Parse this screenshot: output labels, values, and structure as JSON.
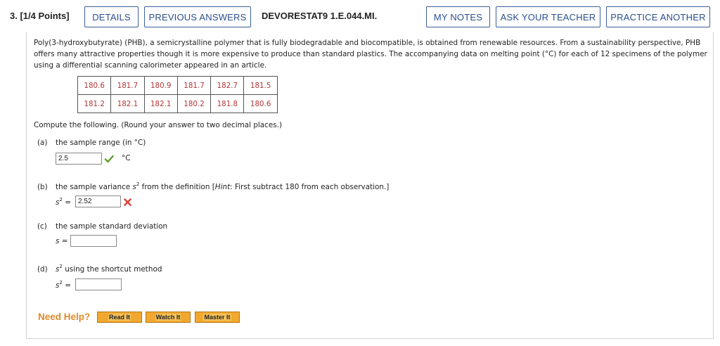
{
  "header": {
    "question_label": "3. [1/4 Points]",
    "details_label": "DETAILS",
    "previous_answers_label": "PREVIOUS ANSWERS",
    "question_id": "DEVORESTAT9 1.E.044.MI.",
    "my_notes_label": "MY NOTES",
    "ask_teacher_label": "ASK YOUR TEACHER",
    "practice_another_label": "PRACTICE ANOTHER"
  },
  "intro": {
    "line1": "Poly(3-hydroxybutyrate) (PHB), a semicrystalline polymer that is fully biodegradable and biocompatible, is obtained from renewable resources. From a sustainability perspective, PHB",
    "line2": "offers many attractive properties though it is more expensive to produce than standard plastics. The accompanying data on melting point (°C) for each of 12 specimens of the polymer",
    "line3": "using a differential scanning calorimeter appeared in an article."
  },
  "data_table": {
    "rows": [
      [
        "180.6",
        "181.7",
        "180.9",
        "181.7",
        "182.7",
        "181.5"
      ],
      [
        "181.2",
        "182.1",
        "182.1",
        "180.2",
        "181.8",
        "180.6"
      ]
    ]
  },
  "instructions": "Compute the following. (Round your answer to two decimal places.)",
  "parts": {
    "a": {
      "letter": "(a)",
      "text": "the sample range (in °C)",
      "value": "2.5",
      "unit": "°C",
      "status": "correct"
    },
    "b": {
      "letter": "(b)",
      "text_before": "the sample variance ",
      "var": "s",
      "sup": "2",
      "text_after": " from the definition [",
      "hint_label": "Hint",
      "hint_text": ": First subtract 180 from each observation.]",
      "answer_var": "s",
      "answer_sup": "2",
      "equals": " =",
      "value": "2.52",
      "status": "incorrect"
    },
    "c": {
      "letter": "(c)",
      "text": "the sample standard deviation",
      "answer_var": "s",
      "equals": " =",
      "value": ""
    },
    "d": {
      "letter": "(d)",
      "var": "s",
      "sup": "2",
      "text": " using the shortcut method",
      "answer_var": "s",
      "answer_sup": "2",
      "equals": " =",
      "value": ""
    }
  },
  "help": {
    "label": "Need Help?",
    "read_label": "Read It",
    "watch_label": "Watch It",
    "master_label": "Master It"
  },
  "colors": {
    "button_border": "#3b5e9a",
    "table_text": "#b33636",
    "need_help": "#e08a2a",
    "correct": "#5aa02c",
    "incorrect": "#d9443a"
  },
  "icons": {
    "correct": "check-icon",
    "incorrect": "x-icon"
  }
}
